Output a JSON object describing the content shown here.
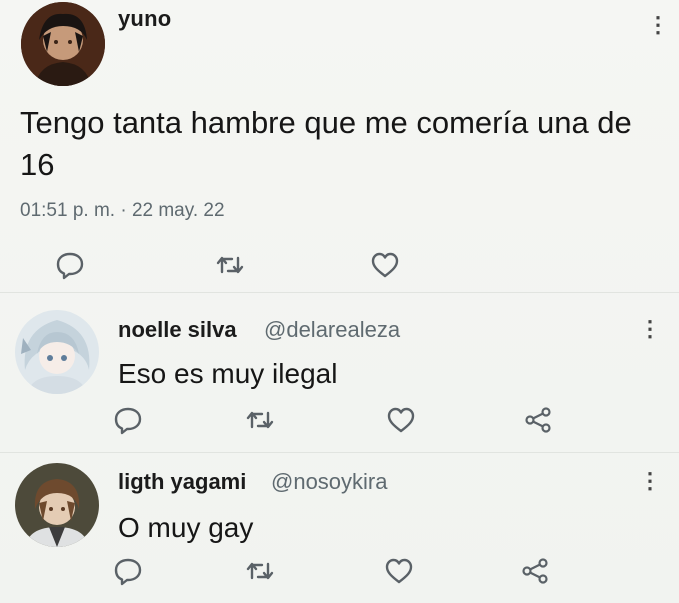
{
  "tweet": {
    "username": "yuno",
    "text": "Tengo tanta hambre que me comería una de 16",
    "timestamp": "01:51 p. m. · 22 may. 22",
    "actions": [
      "reply-icon",
      "retweet-icon",
      "like-icon"
    ]
  },
  "replies": [
    {
      "name": "noelle silva",
      "handle": "@delarealeza",
      "text": "Eso es muy ilegal",
      "actions": [
        "reply-icon",
        "retweet-icon",
        "like-icon",
        "share-icon"
      ]
    },
    {
      "name": "ligth yagami",
      "handle": "@nosoykira",
      "text": "O muy gay",
      "actions": [
        "reply-icon",
        "retweet-icon",
        "like-icon",
        "share-icon"
      ]
    }
  ],
  "icons": {
    "menu": "⋮"
  },
  "colors": {
    "background": "#f3f5f2",
    "text": "#161616",
    "muted": "#5f6a70",
    "icon": "#5a6167"
  }
}
